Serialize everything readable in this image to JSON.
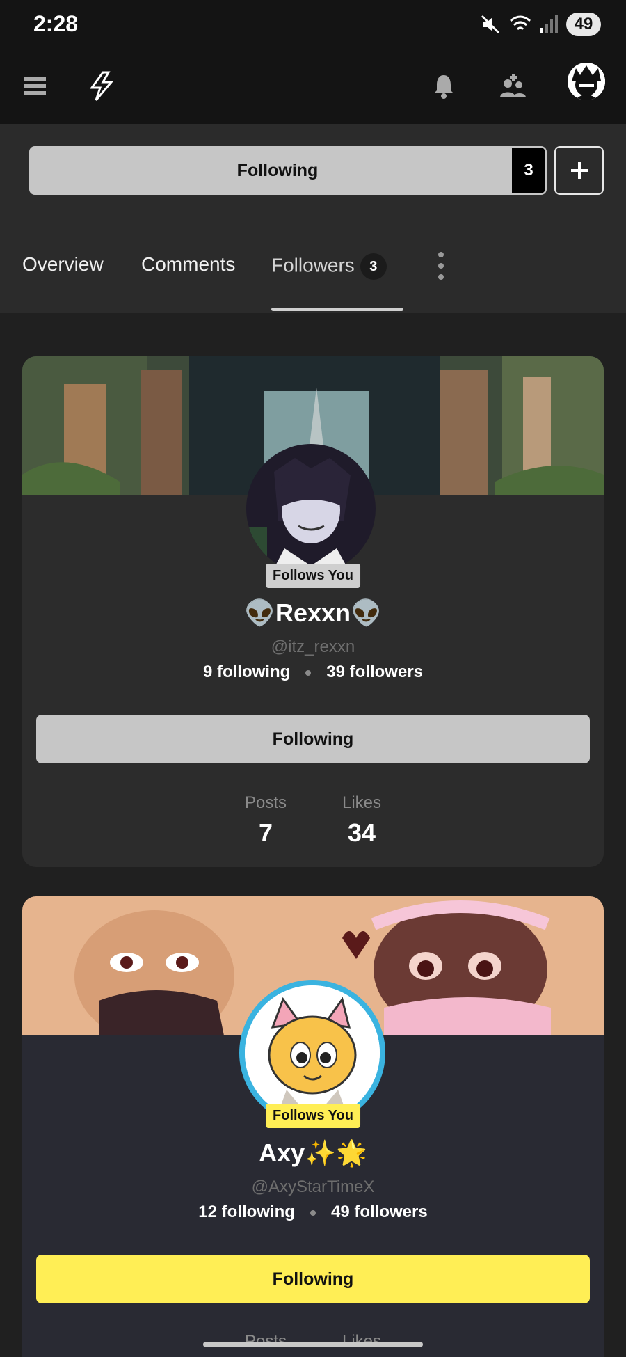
{
  "status_bar": {
    "time": "2:28",
    "battery": "49"
  },
  "app_bar": {
    "menu_icon": "hamburger-icon",
    "logo_icon": "lightning-logo-icon",
    "notifications_icon": "bell-icon",
    "people_icon": "add-people-icon",
    "avatar_icon": "profile-avatar"
  },
  "follow_bar": {
    "label": "Following",
    "count": "3",
    "plus_icon": "plus-icon"
  },
  "tabs": [
    {
      "label": "Overview"
    },
    {
      "label": "Comments"
    },
    {
      "label": "Followers",
      "badge": "3",
      "active": true
    }
  ],
  "followers": [
    {
      "badge": "Follows You",
      "name": "👽Rexxn👽",
      "handle": "@itz_rexxn",
      "following": "9 following",
      "followers": "39 followers",
      "button": "Following",
      "posts_label": "Posts",
      "posts": "7",
      "likes_label": "Likes",
      "likes": "34"
    },
    {
      "badge": "Follows You",
      "name": "Axy✨🌟",
      "handle": "@AxyStarTimeX",
      "following": "12 following",
      "followers": "49 followers",
      "button": "Following",
      "posts_label": "Posts",
      "likes_label": "Likes"
    }
  ],
  "colors": {
    "accent_yellow": "#ffee55",
    "button_gray": "#c6c6c6",
    "background": "#202020"
  }
}
